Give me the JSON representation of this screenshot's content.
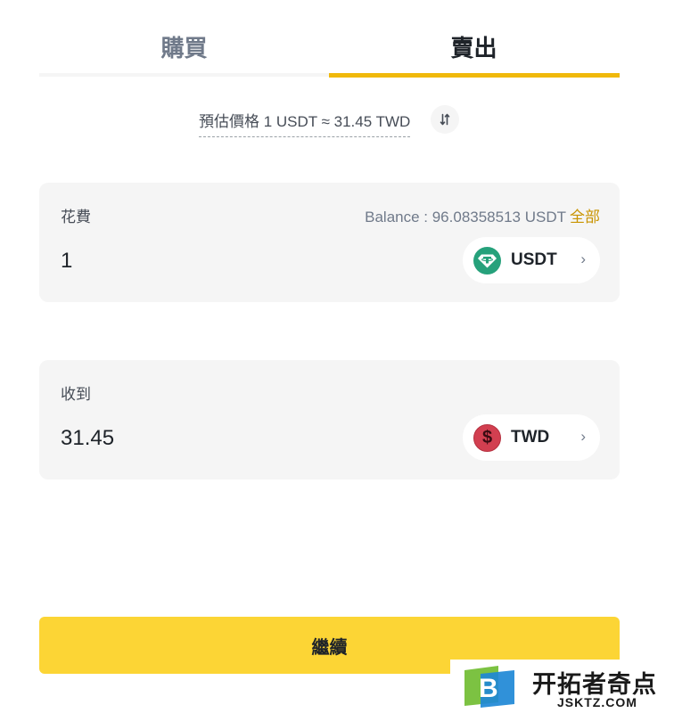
{
  "tabs": [
    {
      "label": "購買",
      "active": false
    },
    {
      "label": "賣出",
      "active": true
    }
  ],
  "rate": {
    "text": "預估價格 1 USDT ≈ 31.45 TWD"
  },
  "spend": {
    "label": "花費",
    "balance": "Balance : 96.08358513 USDT",
    "max_label": "全部",
    "amount": "1",
    "currency": "USDT",
    "icon": "tether-icon"
  },
  "receive": {
    "label": "收到",
    "amount": "31.45",
    "currency": "TWD",
    "icon": "dollar-icon"
  },
  "continue_label": "繼續",
  "watermark": {
    "logo_letter": "B",
    "text": "开拓者奇点",
    "url": "JSKTZ.COM"
  },
  "colors": {
    "accent": "#f0b90b",
    "button": "#fcd535",
    "link": "#c99400",
    "card": "#f5f5f5",
    "usdt": "#26a17b",
    "twd": "#d23f50"
  }
}
